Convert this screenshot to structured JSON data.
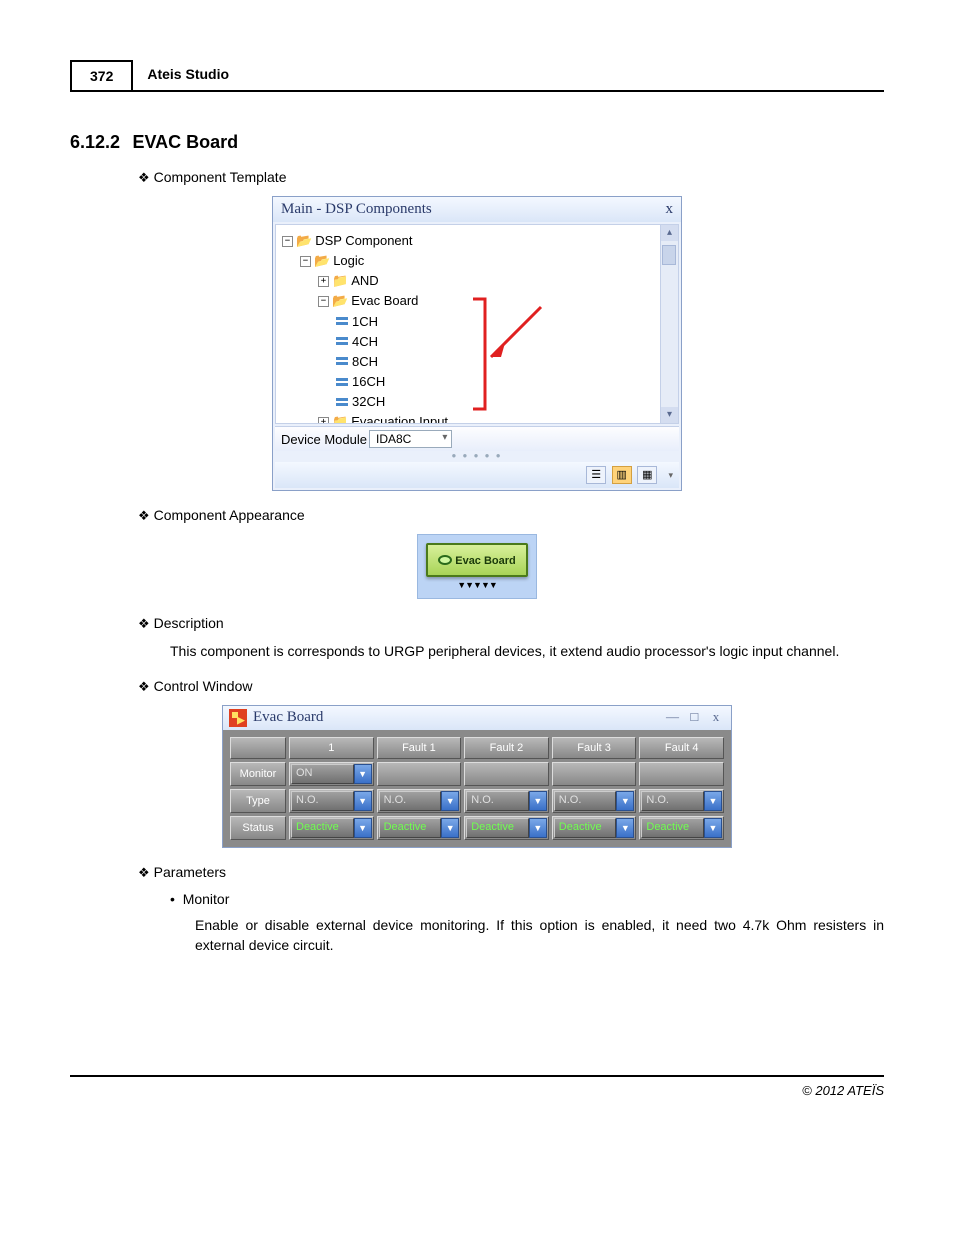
{
  "header": {
    "page_number": "372",
    "title": "Ateis Studio"
  },
  "section": {
    "number": "6.12.2",
    "title": "EVAC Board"
  },
  "subs": {
    "component_template": "Component Template",
    "component_appearance": "Component Appearance",
    "description": "Description",
    "control_window": "Control Window",
    "parameters": "Parameters"
  },
  "tpl": {
    "title": "Main - DSP Components",
    "close": "x",
    "tree": {
      "root": "DSP Component",
      "logic": "Logic",
      "and": "AND",
      "evac": "Evac Board",
      "items": [
        "1CH",
        "4CH",
        "8CH",
        "16CH",
        "32CH"
      ],
      "evinput": "Evacuation Input"
    },
    "dev_label": "Device Module",
    "dev_value": "IDA8C"
  },
  "appearance": {
    "label": "Evac Board"
  },
  "description_text": "This component is corresponds to URGP peripheral devices, it extend audio processor's logic input channel.",
  "ctrl": {
    "title": "Evac Board",
    "cols": [
      "",
      "1",
      "Fault 1",
      "Fault 2",
      "Fault 3",
      "Fault 4"
    ],
    "rows": {
      "monitor": {
        "label": "Monitor",
        "values": [
          "ON",
          "",
          "",
          "",
          ""
        ]
      },
      "type": {
        "label": "Type",
        "values": [
          "N.O.",
          "N.O.",
          "N.O.",
          "N.O.",
          "N.O."
        ]
      },
      "status": {
        "label": "Status",
        "values": [
          "Deactive",
          "Deactive",
          "Deactive",
          "Deactive",
          "Deactive"
        ]
      }
    }
  },
  "param_monitor": {
    "name": "Monitor",
    "text": "Enable or disable external device monitoring. If this option is enabled, it need two 4.7k Ohm resisters in external device circuit."
  },
  "footer": "© 2012 ATEÏS"
}
